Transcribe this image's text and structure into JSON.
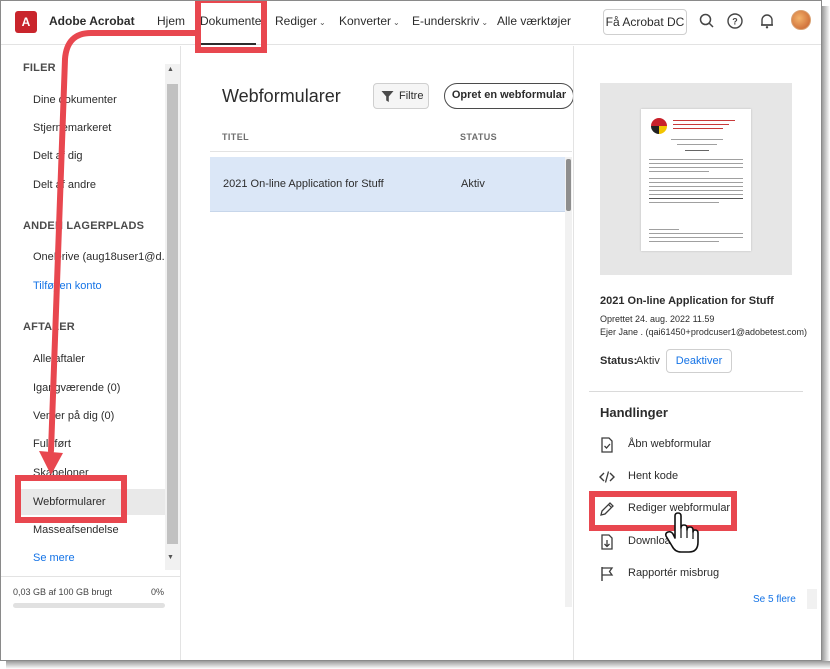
{
  "nav": {
    "logo_glyph": "A",
    "app_name": "Adobe Acrobat",
    "items": [
      "Hjem",
      "Dokumenter",
      "Rediger",
      "Konverter",
      "E-underskriv",
      "Alle værktøjer"
    ],
    "cta": "Få Acrobat DC"
  },
  "sidebar": {
    "files_head": "FILER",
    "files": [
      "Dine dokumenter",
      "Stjernemarkeret",
      "Delt af dig",
      "Delt af andre"
    ],
    "storage_head": "ANDEN LAGERPLADS",
    "storage_items": [
      "OneDrive (aug18user1@d...",
      "Tilføj en konto"
    ],
    "agreements_head": "AFTALER",
    "agreements": [
      "Alle aftaler",
      "Igangværende (0)",
      "Venter på dig (0)",
      "Fuldført",
      "Skabeloner",
      "Webformularer",
      "Masseafsendelse",
      "Se mere"
    ],
    "storage_used": "0,03 GB af 100 GB brugt",
    "storage_pct": "0%"
  },
  "main": {
    "title": "Webformularer",
    "filter": "Filtre",
    "create": "Opret en webformular",
    "col_title": "TITEL",
    "col_status": "STATUS",
    "rows": [
      {
        "title": "2021 On-line Application for Stuff",
        "status": "Aktiv"
      }
    ]
  },
  "panel": {
    "doc_title": "2021 On-line Application for Stuff",
    "created": "Oprettet 24. aug. 2022 11.59",
    "owner": "Ejer Jane . (qai61450+prodcuser1@adobetest.com)",
    "status_label": "Status:",
    "status_value": "Aktiv",
    "deactivate": "Deaktiver",
    "actions_head": "Handlinger",
    "actions": [
      "Åbn webformular",
      "Hent kode",
      "Rediger webformular",
      "Download",
      "Rapportér misbrug"
    ],
    "see_more": "Se 5 flere"
  },
  "colors": {
    "accent_blue": "#1473e6",
    "highlight_red": "#e8474f",
    "selected_row": "#dbe7f7"
  },
  "icons": [
    "adobe-acrobat-logo-icon",
    "search-icon",
    "help-icon",
    "bell-icon",
    "avatar",
    "filter-icon",
    "open-form-icon",
    "code-icon",
    "pencil-icon",
    "download-icon",
    "flag-icon",
    "hand-cursor-icon"
  ]
}
